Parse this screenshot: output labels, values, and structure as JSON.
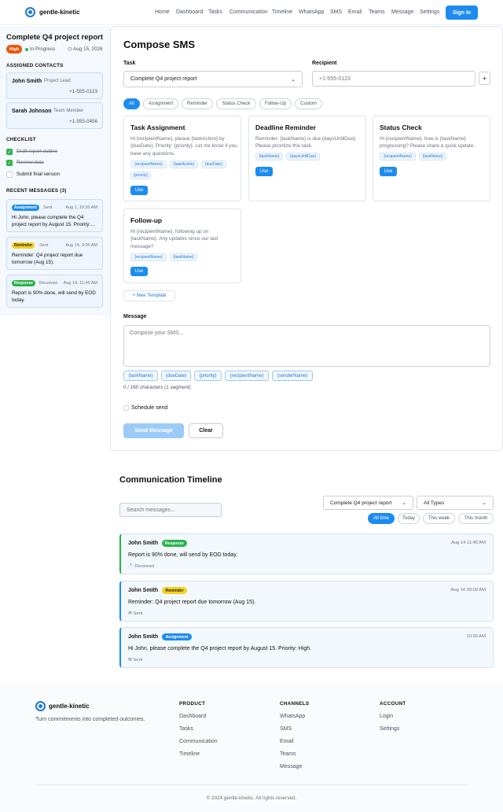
{
  "header": {
    "brand": "gentle-kinetic",
    "nav": [
      "Home",
      "Dashboard",
      "Tasks",
      "Communication",
      "Timeline",
      "WhatsApp",
      "SMS",
      "Email",
      "Teams",
      "Message",
      "Settings"
    ],
    "signin": "Sign In"
  },
  "sidebar": {
    "task_title": "Complete Q4 project report",
    "priority": "High",
    "status": "In Progress",
    "due": "Aug 15, 2026",
    "contacts_title": "ASSIGNED CONTACTS",
    "contacts": [
      {
        "name": "John Smith",
        "role": "Project Lead",
        "phone": "+1-555-0123"
      },
      {
        "name": "Sarah Johnson",
        "role": "Team Member",
        "phone": "+1-555-0456"
      }
    ],
    "checklist_title": "CHECKLIST",
    "checklist": [
      {
        "label": "Draft report outline",
        "done": true
      },
      {
        "label": "Review data",
        "done": true
      },
      {
        "label": "Submit final version",
        "done": false
      }
    ],
    "recent_title": "RECENT MESSAGES (3)",
    "recent": [
      {
        "type": "Assignment",
        "dir": "Sent",
        "time": "Aug 1, 10:30 AM",
        "text": "Hi John, please complete the Q4 project report by August 15. Priority:..."
      },
      {
        "type": "Reminder",
        "dir": "Sent",
        "time": "Aug 14, 9:00 AM",
        "text": "Reminder: Q4 project report due tomorrow (Aug 15)."
      },
      {
        "type": "Response",
        "dir": "Received",
        "time": "Aug 14, 11:45 AM",
        "text": "Report is 90% done, will send by EOD today."
      }
    ]
  },
  "compose": {
    "title": "Compose SMS",
    "task_label": "Task",
    "task_value": "Complete Q4 project report",
    "recipient_label": "Recipient",
    "recipient_placeholder": "+1-555-0123",
    "add": "+",
    "filters": [
      "All",
      "Assignment",
      "Reminder",
      "Status Check",
      "Follow-Up",
      "Custom"
    ],
    "templates": [
      {
        "title": "Task Assignment",
        "body": "Hi {recipientName}, please {taskAction} by {dueDate}. Priority: {priority}. Let me know if you have any questions.",
        "tags": [
          "{recipientName}",
          "{taskAction}",
          "{dueDate}",
          "{priority}"
        ],
        "use": "Use"
      },
      {
        "title": "Deadline Reminder",
        "body": "Reminder: {taskName} is due {daysUntilDue}. Please prioritize this task.",
        "tags": [
          "{taskName}",
          "{daysUntilDue}"
        ],
        "use": "Use"
      },
      {
        "title": "Status Check",
        "body": "Hi {recipientName}, how is {taskName} progressing? Please share a quick update.",
        "tags": [
          "{recipientName}",
          "{taskName}"
        ],
        "use": "Use"
      },
      {
        "title": "Follow-up",
        "body": "Hi {recipientName}, following up on {taskName}. Any updates since our last message?",
        "tags": [
          "{recipientName}",
          "{taskName}"
        ],
        "use": "Use"
      }
    ],
    "new_template": "+ New Template",
    "message_label": "Message",
    "message_placeholder": "Compose your SMS...",
    "variables": [
      "{taskName}",
      "{dueDate}",
      "{priority}",
      "{recipientName}",
      "{senderName}"
    ],
    "char_count": "0 / 160 characters (1 segment)",
    "schedule": "Schedule send",
    "send": "Send Message",
    "clear": "Clear"
  },
  "timeline": {
    "title": "Communication Timeline",
    "search_placeholder": "Search messages...",
    "task_filter": "Complete Q4 project report",
    "type_filter": "All Types",
    "ranges": [
      "All time",
      "Today",
      "This week",
      "This month"
    ],
    "messages": [
      {
        "name": "John Smith",
        "type": "Response",
        "time": "Aug 14 11:45 AM",
        "text": "Report is 90% done, will send by EOD today.",
        "status": "Received",
        "status_icon": "inbox-icon"
      },
      {
        "name": "John Smith",
        "type": "Reminder",
        "time": "Aug 14 09:00 AM",
        "text": "Reminder: Q4 project report due tomorrow (Aug 15).",
        "status": "Sent",
        "status_icon": "envelope-icon"
      },
      {
        "name": "John Smith",
        "type": "Assignment",
        "time": "10:30 AM",
        "text": "Hi John, please complete the Q4 project report by August 15. Priority: High.",
        "status": "Sent",
        "status_icon": "envelope-icon"
      }
    ]
  },
  "footer": {
    "brand": "gentle-kinetic",
    "tagline": "Turn commitments into completed outcomes.",
    "cols": [
      {
        "title": "PRODUCT",
        "links": [
          "Dashboard",
          "Tasks",
          "Communication",
          "Timeline"
        ]
      },
      {
        "title": "CHANNELS",
        "links": [
          "WhatsApp",
          "SMS",
          "Email",
          "Teams",
          "Message"
        ]
      },
      {
        "title": "ACCOUNT",
        "links": [
          "Login",
          "Settings"
        ]
      }
    ],
    "copyright": "© 2024 gentle-kinetic. All rights reserved."
  },
  "colors": {
    "accent": "#1d8cf0",
    "high": "#e8590c",
    "success": "#2bb34b",
    "warning": "#f4d21f"
  }
}
